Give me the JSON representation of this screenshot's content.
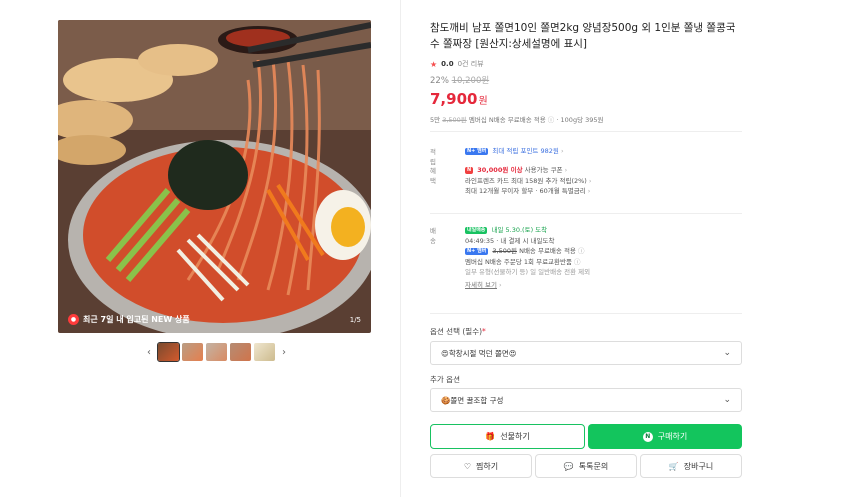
{
  "gallery": {
    "badge_text": "최근 7일 내 입고된 NEW 상품",
    "page_indicator": "1/5",
    "prev_label": "‹",
    "next_label": "›"
  },
  "product": {
    "title": "참도깨비 남포 쫄면10인 쫄면2kg 양념장500g 외 1인분 쫄냉 쫄콩국수 쫄짜장 [원산지:상세설명에 표시]",
    "rating_score": "0.0",
    "reviews_label": "0건 리뷰",
    "discount_pct": "22%",
    "original_price": "10,200원",
    "price_num": "7,900",
    "price_unit": "원",
    "shipping_prefix": "5만",
    "shipping_strike": "3,500원",
    "shipping_text": "멤버십 N배송 무료배송 적용",
    "unit_price": "100g당 395원"
  },
  "points": {
    "label": "적립",
    "pill": "N+ 멤버",
    "text": "최대 적립 포인트 982원"
  },
  "benefits": {
    "label": "혜택",
    "pill": "N",
    "line1_bold": "30,000원 이상",
    "line1_rest": "사용가능 쿠폰",
    "line2": "라인프렌즈 카드 최대 158원 추가 적립(2%)",
    "line3": "최대 12개월 무이자 할부 · 60개월 특별금리"
  },
  "delivery": {
    "label": "배송",
    "pill": "내일배송",
    "arrival": "내일 5.30.(토) 도착",
    "deadline": "04:49:35 · 내 결제 시 내일도착",
    "line3_pill": "N+ 멤버",
    "line3_strike": "3,500원",
    "line3_rest": "N배송 무료배송 적용",
    "line4": "멤버십 N배송 주문당 1회 무료교환반품",
    "line5": "일부 유형(선물하기 등) 일 일반배송 전환 제외",
    "more_link": "자세히 보기"
  },
  "options": {
    "label1": "옵션 선택",
    "label1_req": "(필수)",
    "label1_star": "*",
    "select1_value": "😍학창시절 먹던 쫄면😍",
    "label2": "추가 옵션",
    "select2_value": "🍪쫄면 꿀조합 구성"
  },
  "actions": {
    "gift": "선물하기",
    "buy": "구매하기",
    "wish": "찜하기",
    "talk": "톡톡문의",
    "cart": "장바구니"
  },
  "colors": {
    "accent_green": "#13c55d",
    "price_red": "#e5283b"
  }
}
